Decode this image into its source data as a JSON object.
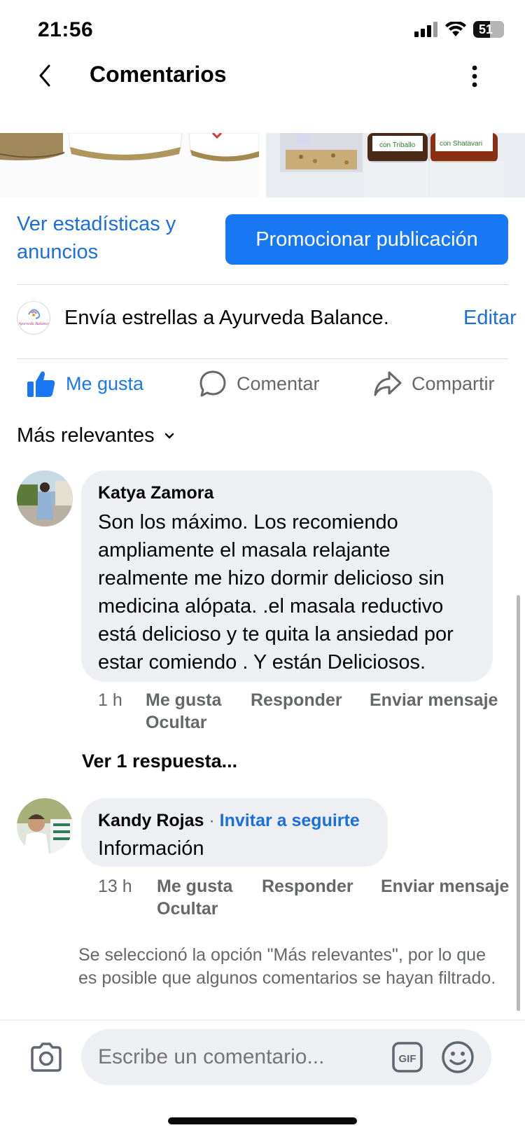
{
  "status_bar": {
    "time": "21:56",
    "battery": "51"
  },
  "header": {
    "title": "Comentarios"
  },
  "post": {
    "stats_link": "Ver estadísticas y anuncios",
    "promote_button": "Promocionar publicación",
    "stars_text": "Envía estrellas a Ayurveda Balance.",
    "edit_link": "Editar",
    "page_logo_text": "Ayurveda Balance",
    "image_labels": [
      "con Triballo",
      "con Shatavari"
    ]
  },
  "actions": {
    "like": "Me gusta",
    "comment": "Comentar",
    "share": "Compartir"
  },
  "filter": {
    "label": "Más relevantes"
  },
  "comments": [
    {
      "author": "Katya Zamora",
      "text": "Son los máximo. Los recomiendo ampliamente el masala relajante realmente me hizo dormir delicioso sin medicina alópata. .el masala reductivo está delicioso y te quita la ansiedad por estar comiendo . Y están Deliciosos.",
      "time": "1 h",
      "like": "Me gusta",
      "reply": "Responder",
      "message": "Enviar mensaje",
      "hide": "Ocultar",
      "replies_link": "Ver 1 respuesta..."
    },
    {
      "author": "Kandy Rojas",
      "invite": "Invitar a seguirte",
      "text": "Información",
      "time": "13 h",
      "like": "Me gusta",
      "reply": "Responder",
      "message": "Enviar mensaje",
      "hide": "Ocultar"
    }
  ],
  "filter_note": "Se seleccionó la opción \"Más relevantes\", por lo que es posible que algunos comentarios se hayan filtrado.",
  "composer": {
    "placeholder": "Escribe un comentario..."
  },
  "colors": {
    "accent": "#1877f2",
    "link": "#1b6fdd",
    "bubble": "#eeeff3",
    "muted": "#65676b"
  },
  "icons": [
    "back-arrow-icon",
    "more-vertical-icon",
    "thumbs-up-icon",
    "comment-icon",
    "share-icon",
    "chevron-down-icon",
    "camera-icon",
    "gif-icon",
    "emoji-icon"
  ]
}
